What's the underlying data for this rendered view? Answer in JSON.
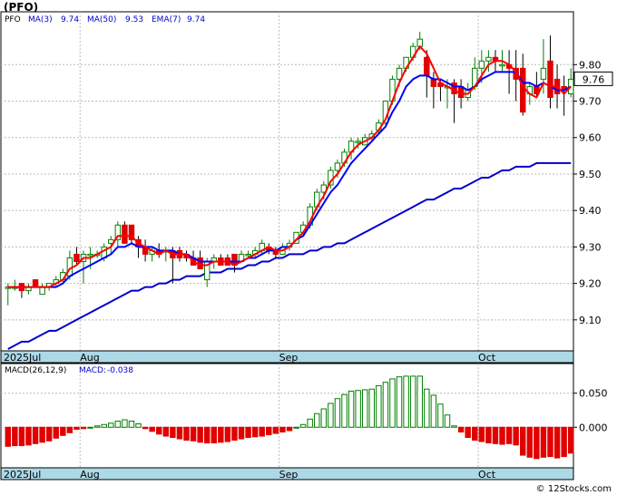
{
  "title": "(PFO)",
  "watermark": "© 12Stocks.com",
  "colors": {
    "up": "#008000",
    "down": "#e00000",
    "ma3": "#ff0000",
    "ma50": "#0000cc",
    "ema7": "#0000ff",
    "grid": "#bbbbbb",
    "date_band": "#add8e6"
  },
  "chart_data": [
    {
      "type": "candlestick",
      "ticker": "PFO",
      "legend": {
        "ticker": "PFO",
        "ma3_label": "MA(3)",
        "ma3_value": "9.74",
        "ma50_label": "MA(50)",
        "ma50_value": "9.53",
        "ema7_label": "EMA(7)",
        "ema7_value": "9.74"
      },
      "last_price": "9.76",
      "ylim": [
        9.015,
        9.945
      ],
      "y_ticks": [
        {
          "value": 9.1,
          "label": "9.10"
        },
        {
          "value": 9.2,
          "label": "9.20"
        },
        {
          "value": 9.3,
          "label": "9.30"
        },
        {
          "value": 9.4,
          "label": "9.40"
        },
        {
          "value": 9.5,
          "label": "9.50"
        },
        {
          "value": 9.6,
          "label": "9.60"
        },
        {
          "value": 9.7,
          "label": "9.70"
        },
        {
          "value": 9.8,
          "label": "9.80"
        }
      ],
      "grid": true,
      "x_labels": [
        {
          "index": 0,
          "label": "2025Jul"
        },
        {
          "index": 11,
          "label": "Aug"
        },
        {
          "index": 40,
          "label": "Sep"
        },
        {
          "index": 69,
          "label": "Oct"
        }
      ],
      "candles": [
        [
          9.19,
          9.2,
          9.14,
          9.19
        ],
        [
          9.19,
          9.21,
          9.18,
          9.19
        ],
        [
          9.2,
          9.2,
          9.16,
          9.18
        ],
        [
          9.18,
          9.2,
          9.17,
          9.19
        ],
        [
          9.21,
          9.21,
          9.19,
          9.19
        ],
        [
          9.17,
          9.2,
          9.17,
          9.19
        ],
        [
          9.19,
          9.2,
          9.18,
          9.2
        ],
        [
          9.2,
          9.22,
          9.19,
          9.21
        ],
        [
          9.21,
          9.24,
          9.2,
          9.23
        ],
        [
          9.22,
          9.29,
          9.21,
          9.27
        ],
        [
          9.28,
          9.3,
          9.25,
          9.26
        ],
        [
          9.26,
          9.29,
          9.2,
          9.28
        ],
        [
          9.28,
          9.3,
          9.24,
          9.28
        ],
        [
          9.28,
          9.29,
          9.27,
          9.28
        ],
        [
          9.27,
          9.31,
          9.26,
          9.3
        ],
        [
          9.31,
          9.33,
          9.28,
          9.32
        ],
        [
          9.32,
          9.37,
          9.3,
          9.36
        ],
        [
          9.36,
          9.37,
          9.31,
          9.31
        ],
        [
          9.36,
          9.36,
          9.31,
          9.32
        ],
        [
          9.32,
          9.33,
          9.27,
          9.3
        ],
        [
          9.3,
          9.32,
          9.26,
          9.28
        ],
        [
          9.28,
          9.3,
          9.26,
          9.29
        ],
        [
          9.29,
          9.31,
          9.27,
          9.28
        ],
        [
          9.29,
          9.3,
          9.26,
          9.29
        ],
        [
          9.29,
          9.3,
          9.2,
          9.27
        ],
        [
          9.29,
          9.3,
          9.26,
          9.27
        ],
        [
          9.28,
          9.29,
          9.26,
          9.27
        ],
        [
          9.27,
          9.29,
          9.25,
          9.25
        ],
        [
          9.27,
          9.29,
          9.24,
          9.24
        ],
        [
          9.21,
          9.27,
          9.19,
          9.26
        ],
        [
          9.26,
          9.28,
          9.24,
          9.27
        ],
        [
          9.27,
          9.28,
          9.25,
          9.25
        ],
        [
          9.27,
          9.28,
          9.25,
          9.25
        ],
        [
          9.28,
          9.28,
          9.23,
          9.25
        ],
        [
          9.26,
          9.29,
          9.26,
          9.28
        ],
        [
          9.28,
          9.29,
          9.27,
          9.28
        ],
        [
          9.28,
          9.3,
          9.27,
          9.29
        ],
        [
          9.29,
          9.32,
          9.28,
          9.31
        ],
        [
          9.3,
          9.31,
          9.28,
          9.29
        ],
        [
          9.29,
          9.3,
          9.27,
          9.28
        ],
        [
          9.28,
          9.31,
          9.28,
          9.3
        ],
        [
          9.3,
          9.32,
          9.29,
          9.31
        ],
        [
          9.31,
          9.34,
          9.31,
          9.34
        ],
        [
          9.34,
          9.37,
          9.33,
          9.36
        ],
        [
          9.36,
          9.42,
          9.35,
          9.41
        ],
        [
          9.41,
          9.46,
          9.4,
          9.45
        ],
        [
          9.45,
          9.48,
          9.43,
          9.47
        ],
        [
          9.47,
          9.52,
          9.46,
          9.51
        ],
        [
          9.51,
          9.54,
          9.49,
          9.53
        ],
        [
          9.53,
          9.57,
          9.52,
          9.56
        ],
        [
          9.56,
          9.6,
          9.54,
          9.59
        ],
        [
          9.59,
          9.6,
          9.57,
          9.59
        ],
        [
          9.58,
          9.61,
          9.58,
          9.6
        ],
        [
          9.6,
          9.62,
          9.59,
          9.61
        ],
        [
          9.62,
          9.65,
          9.61,
          9.64
        ],
        [
          9.64,
          9.7,
          9.63,
          9.7
        ],
        [
          9.7,
          9.77,
          9.69,
          9.76
        ],
        [
          9.76,
          9.8,
          9.74,
          9.79
        ],
        [
          9.79,
          9.82,
          9.78,
          9.82
        ],
        [
          9.82,
          9.86,
          9.81,
          9.85
        ],
        [
          9.85,
          9.89,
          9.84,
          9.87
        ],
        [
          9.82,
          9.84,
          9.71,
          9.77
        ],
        [
          9.76,
          9.78,
          9.68,
          9.74
        ],
        [
          9.75,
          9.76,
          9.7,
          9.74
        ],
        [
          9.74,
          9.76,
          9.68,
          9.74
        ],
        [
          9.75,
          9.76,
          9.64,
          9.72
        ],
        [
          9.74,
          9.76,
          9.68,
          9.71
        ],
        [
          9.71,
          9.75,
          9.7,
          9.73
        ],
        [
          9.74,
          9.82,
          9.73,
          9.79
        ],
        [
          9.79,
          9.84,
          9.75,
          9.81
        ],
        [
          9.81,
          9.84,
          9.78,
          9.82
        ],
        [
          9.82,
          9.84,
          9.78,
          9.81
        ],
        [
          9.8,
          9.84,
          9.78,
          9.8
        ],
        [
          9.8,
          9.84,
          9.72,
          9.79
        ],
        [
          9.79,
          9.84,
          9.7,
          9.76
        ],
        [
          9.79,
          9.83,
          9.66,
          9.67
        ],
        [
          9.72,
          9.75,
          9.69,
          9.74
        ],
        [
          9.74,
          9.78,
          9.71,
          9.72
        ],
        [
          9.76,
          9.87,
          9.72,
          9.79
        ],
        [
          9.81,
          9.88,
          9.68,
          9.71
        ],
        [
          9.76,
          9.8,
          9.68,
          9.72
        ],
        [
          9.74,
          9.77,
          9.66,
          9.73
        ],
        [
          9.72,
          9.79,
          9.71,
          9.76
        ]
      ],
      "ma3": [
        9.19,
        9.19,
        9.19,
        9.19,
        9.19,
        9.19,
        9.19,
        9.2,
        9.21,
        9.24,
        9.25,
        9.27,
        9.27,
        9.28,
        9.29,
        9.3,
        9.33,
        9.33,
        9.33,
        9.31,
        9.3,
        9.29,
        9.28,
        9.29,
        9.28,
        9.28,
        9.28,
        9.26,
        9.25,
        9.25,
        9.26,
        9.26,
        9.26,
        9.25,
        9.26,
        9.27,
        9.28,
        9.29,
        9.3,
        9.29,
        9.29,
        9.3,
        9.32,
        9.34,
        9.37,
        9.41,
        9.44,
        9.48,
        9.5,
        9.53,
        9.56,
        9.58,
        9.59,
        9.6,
        9.62,
        9.65,
        9.7,
        9.75,
        9.79,
        9.82,
        9.85,
        9.83,
        9.79,
        9.75,
        9.74,
        9.73,
        9.72,
        9.72,
        9.74,
        9.77,
        9.8,
        9.81,
        9.81,
        9.8,
        9.78,
        9.74,
        9.72,
        9.71,
        9.75,
        9.74,
        9.74,
        9.72,
        9.74
      ],
      "ema7": [
        9.19,
        9.19,
        9.19,
        9.19,
        9.19,
        9.19,
        9.19,
        9.19,
        9.2,
        9.22,
        9.23,
        9.24,
        9.25,
        9.26,
        9.27,
        9.28,
        9.3,
        9.3,
        9.31,
        9.3,
        9.3,
        9.3,
        9.29,
        9.29,
        9.29,
        9.28,
        9.28,
        9.27,
        9.26,
        9.26,
        9.26,
        9.26,
        9.26,
        9.26,
        9.26,
        9.27,
        9.27,
        9.28,
        9.29,
        9.29,
        9.3,
        9.3,
        9.32,
        9.33,
        9.36,
        9.39,
        9.42,
        9.45,
        9.47,
        9.5,
        9.53,
        9.55,
        9.57,
        9.59,
        9.61,
        9.63,
        9.67,
        9.7,
        9.74,
        9.76,
        9.77,
        9.77,
        9.76,
        9.76,
        9.75,
        9.74,
        9.74,
        9.73,
        9.74,
        9.76,
        9.77,
        9.78,
        9.78,
        9.78,
        9.78,
        9.75,
        9.75,
        9.74,
        9.75,
        9.74,
        9.73,
        9.73,
        9.74
      ],
      "ma50": [
        9.02,
        9.03,
        9.04,
        9.04,
        9.05,
        9.06,
        9.07,
        9.07,
        9.08,
        9.09,
        9.1,
        9.11,
        9.12,
        9.13,
        9.14,
        9.15,
        9.16,
        9.17,
        9.18,
        9.18,
        9.19,
        9.19,
        9.2,
        9.2,
        9.21,
        9.21,
        9.22,
        9.22,
        9.22,
        9.23,
        9.23,
        9.23,
        9.24,
        9.24,
        9.24,
        9.25,
        9.25,
        9.26,
        9.26,
        9.27,
        9.27,
        9.28,
        9.28,
        9.28,
        9.29,
        9.29,
        9.3,
        9.3,
        9.31,
        9.31,
        9.32,
        9.33,
        9.34,
        9.35,
        9.36,
        9.37,
        9.38,
        9.39,
        9.4,
        9.41,
        9.42,
        9.43,
        9.43,
        9.44,
        9.45,
        9.46,
        9.46,
        9.47,
        9.48,
        9.49,
        9.49,
        9.5,
        9.51,
        9.51,
        9.52,
        9.52,
        9.52,
        9.53,
        9.53,
        9.53,
        9.53,
        9.53,
        9.53
      ]
    },
    {
      "type": "bar",
      "legend": {
        "label": "MACD(26,12,9)",
        "macd_label": "MACD:",
        "macd_value": "-0.038"
      },
      "ylim": [
        -0.0595,
        0.0935
      ],
      "y_ticks": [
        {
          "value": 0.0,
          "label": "0.000"
        },
        {
          "value": 0.05,
          "label": "0.050"
        }
      ],
      "x_labels": [
        {
          "index": 0,
          "label": "2025Jul"
        },
        {
          "index": 11,
          "label": "Aug"
        },
        {
          "index": 40,
          "label": "Sep"
        },
        {
          "index": 69,
          "label": "Oct"
        }
      ],
      "values": [
        -0.028,
        -0.027,
        -0.027,
        -0.026,
        -0.024,
        -0.022,
        -0.02,
        -0.016,
        -0.012,
        -0.008,
        -0.003,
        -0.002,
        0.0,
        0.002,
        0.004,
        0.006,
        0.009,
        0.011,
        0.009,
        0.005,
        -0.002,
        -0.006,
        -0.01,
        -0.013,
        -0.015,
        -0.017,
        -0.019,
        -0.02,
        -0.022,
        -0.023,
        -0.023,
        -0.022,
        -0.021,
        -0.019,
        -0.017,
        -0.015,
        -0.014,
        -0.013,
        -0.011,
        -0.009,
        -0.007,
        -0.005,
        0.0,
        0.004,
        0.012,
        0.02,
        0.027,
        0.035,
        0.042,
        0.048,
        0.053,
        0.054,
        0.055,
        0.056,
        0.061,
        0.066,
        0.071,
        0.074,
        0.075,
        0.075,
        0.075,
        0.056,
        0.047,
        0.034,
        0.018,
        0.002,
        -0.007,
        -0.015,
        -0.019,
        -0.021,
        -0.023,
        -0.024,
        -0.025,
        -0.024,
        -0.026,
        -0.041,
        -0.044,
        -0.046,
        -0.044,
        -0.043,
        -0.045,
        -0.043,
        -0.038
      ]
    }
  ]
}
